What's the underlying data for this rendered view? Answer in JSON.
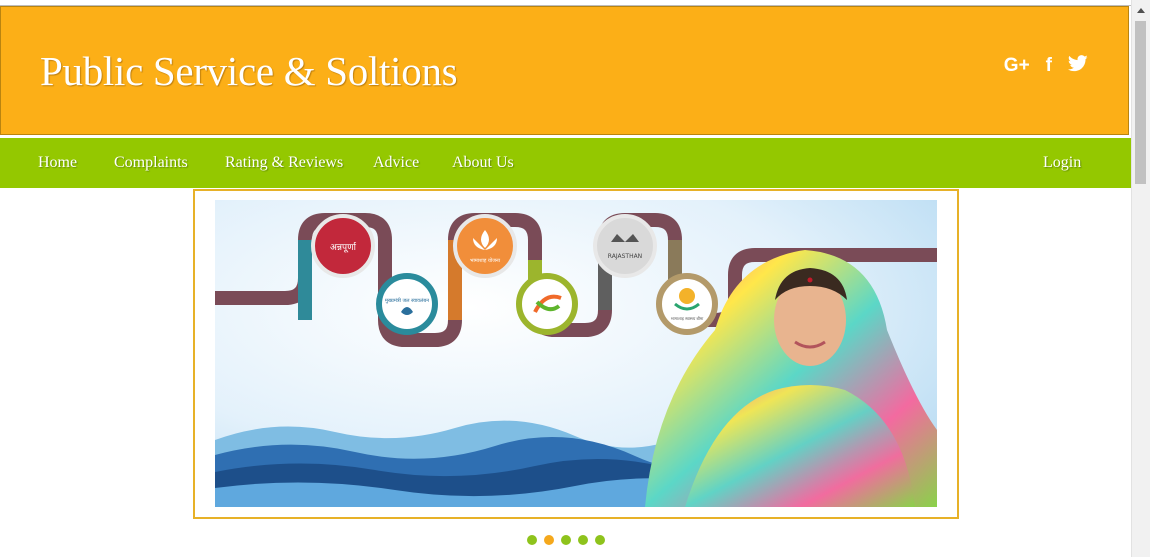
{
  "header": {
    "brand": "Public Service & Soltions",
    "social": [
      {
        "icon": "google-plus-icon",
        "glyph": "G+"
      },
      {
        "icon": "facebook-icon",
        "glyph": "f"
      },
      {
        "icon": "twitter-icon",
        "glyph": "🐦"
      }
    ]
  },
  "nav": {
    "home": "Home",
    "complaints": "Complaints",
    "ratings": "Rating & Reviews",
    "advice": "Advice",
    "about": "About Us",
    "login": "Login"
  },
  "slider": {
    "badge_labels": [
      "अन्नपूर्णा",
      "मुख्यमंत्री जल स्वावलंबन",
      "भामाशाह योजना",
      "RAJASTHAN",
      "भामाशाह स्वास्थ्य बीमा"
    ],
    "dots": 5,
    "active_dot": 1
  },
  "colors": {
    "header_bg": "#fcaf17",
    "nav_bg": "#94c800",
    "frame_border": "#e7b128",
    "dot": "#8ec31c",
    "dot_active": "#f5a81c"
  }
}
